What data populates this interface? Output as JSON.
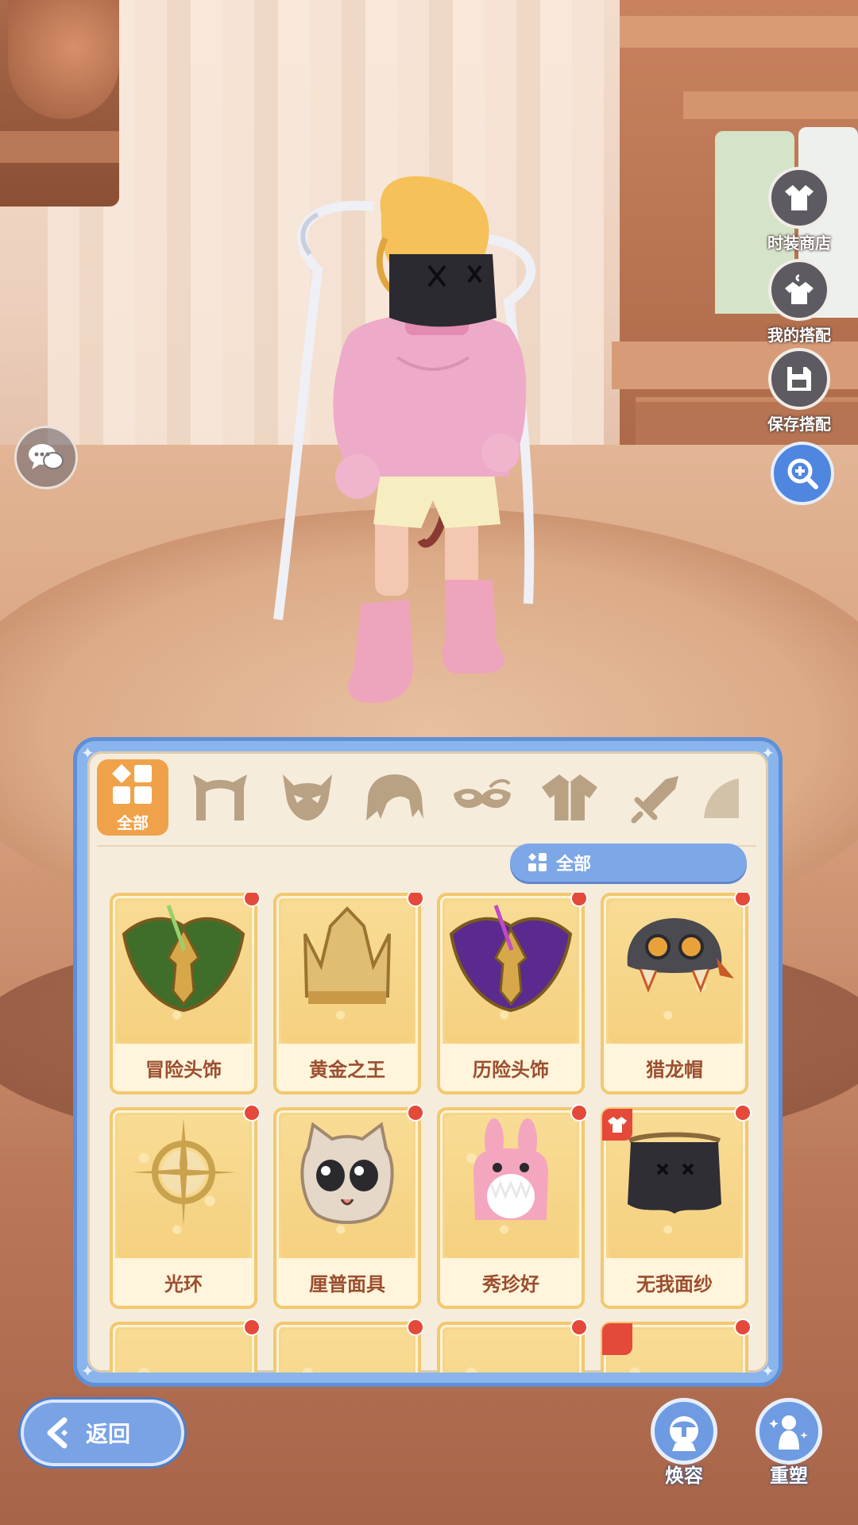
{
  "side_menu": {
    "fashion_shop": "时装商店",
    "my_outfits": "我的搭配",
    "save_outfit": "保存搭配"
  },
  "tabs": {
    "active_label": "全部",
    "icons": [
      "grid-icon",
      "cat-ears-icon",
      "mask-icon",
      "hair-icon",
      "eye-mask-icon",
      "clothing-icon",
      "sword-icon",
      "wing-icon"
    ]
  },
  "filter": {
    "label": "全部"
  },
  "items": [
    {
      "name": "冒险头饰",
      "icon": "green-helmet-icon",
      "new": true
    },
    {
      "name": "黄金之王",
      "icon": "gold-crown-icon",
      "new": true
    },
    {
      "name": "历险头饰",
      "icon": "purple-helmet-icon",
      "new": true
    },
    {
      "name": "猎龙帽",
      "icon": "dragon-hat-icon",
      "new": true
    },
    {
      "name": "光环",
      "icon": "halo-icon",
      "new": true
    },
    {
      "name": "厘普面具",
      "icon": "cat-mask-icon",
      "new": true
    },
    {
      "name": "秀珍好",
      "icon": "bunny-hat-icon",
      "new": true
    },
    {
      "name": "无我面纱",
      "icon": "black-veil-icon",
      "new": true,
      "equipped": true
    }
  ],
  "bottom": {
    "back_label": "返回",
    "makeover_label": "焕容",
    "reshape_label": "重塑"
  },
  "colors": {
    "panel_blue": "#8ab5ec",
    "active_tab": "#f0a24a",
    "new_dot": "#e4493a",
    "item_text": "#9b4e2e"
  }
}
